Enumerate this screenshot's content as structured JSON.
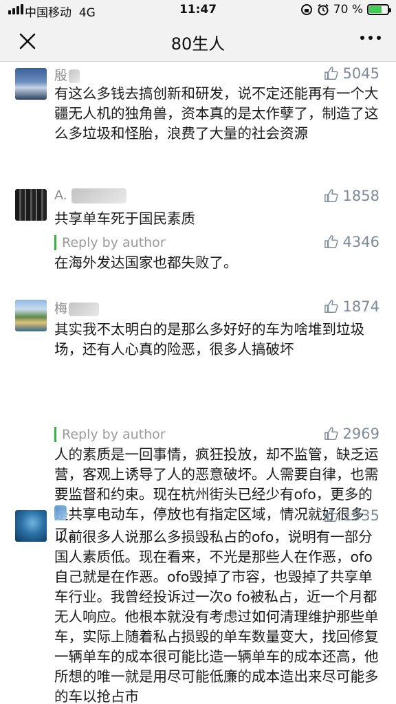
{
  "status": {
    "carrier": "中国移动",
    "network": "4G",
    "time": "11:47",
    "battery_text": "70 %",
    "battery_level": 0.7
  },
  "nav": {
    "title": "80生人"
  },
  "comments": [
    {
      "user": "殷",
      "likes": "5045",
      "text": "有这么多钱去搞创新和研发，说不定还能再有一个大疆无人机的独角兽，资本真的是太作孽了，制造了这么多垃圾和怪胎，浪费了大量的社会资源"
    },
    {
      "user": "A.",
      "likes": "1858",
      "text": "共享单车死于国民素质",
      "reply": {
        "label": "Reply by author",
        "likes": "4346",
        "text": "在海外发达国家也都失败了。"
      }
    },
    {
      "user": "梅",
      "likes": "1874",
      "text": "其实我不太明白的是那么多好好的车为啥堆到垃圾场，还有人心真的险恶，很多人搞破坏",
      "reply": {
        "label": "Reply by author",
        "likes": "2969",
        "text": "人的素质是一回事情，疯狂投放，却不监管，缺乏运营，客观上诱导了人的恶意破坏。人需要自律，也需要监督和约束。现在杭州街头已经少有ofo，更多的是共享电动车，停放也有指定区域，情况就好很多了。"
      }
    },
    {
      "user": "",
      "likes": "1935",
      "text": "以前很多人说那么多损毁私占的ofo，说明有一部分国人素质低。现在看来，不光是那些人在作恶，ofo自己就是在作恶。ofo毁掉了市容，也毁掉了共享单车行业。我曾经投诉过一次o fo被私占，近一个月都无人响应。他根本就没有考虑过如何清理维护那些单车，实际上随着私占损毁的单车数量变大，找回修复一辆单车的成本很可能比造一辆单车的成本还高，他所想的唯一就是用尽可能低廉的成本造出来尽可能多的车以抢占市"
    }
  ],
  "icons": {
    "like": "thumbs-up-icon",
    "close": "close-icon",
    "more": "more-icon"
  },
  "colors": {
    "reply_bar": "#2fb540",
    "likes": "#7d8a99",
    "battery": "#3ccf4e"
  }
}
